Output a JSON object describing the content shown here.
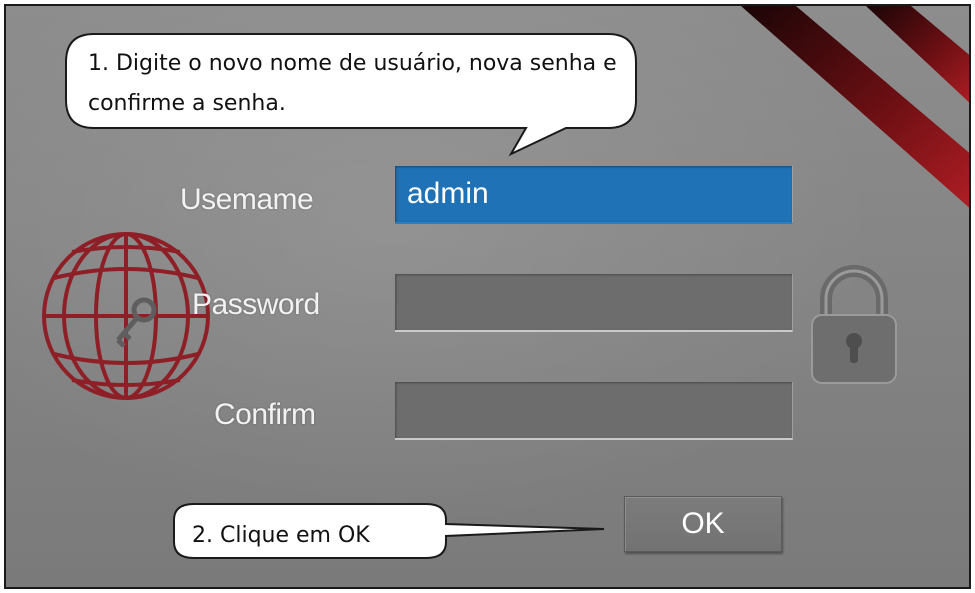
{
  "form": {
    "username_label": "Usemame",
    "username_value": "admin",
    "password_label": "Password",
    "password_value": "",
    "confirm_label": "Confirm",
    "confirm_value": "",
    "ok_label": "OK"
  },
  "callouts": {
    "step1": "1. Digite o novo nome de usuário, nova senha e confirme a senha.",
    "step2": "2. Clique em OK"
  },
  "colors": {
    "background": "#858585",
    "selected_field": "#1e72b5",
    "field": "#6d6d6d",
    "globe": "#8f1f27",
    "stripe": "#7a1216"
  },
  "icons": {
    "globe": "globe-key-icon",
    "lock": "padlock-icon"
  }
}
